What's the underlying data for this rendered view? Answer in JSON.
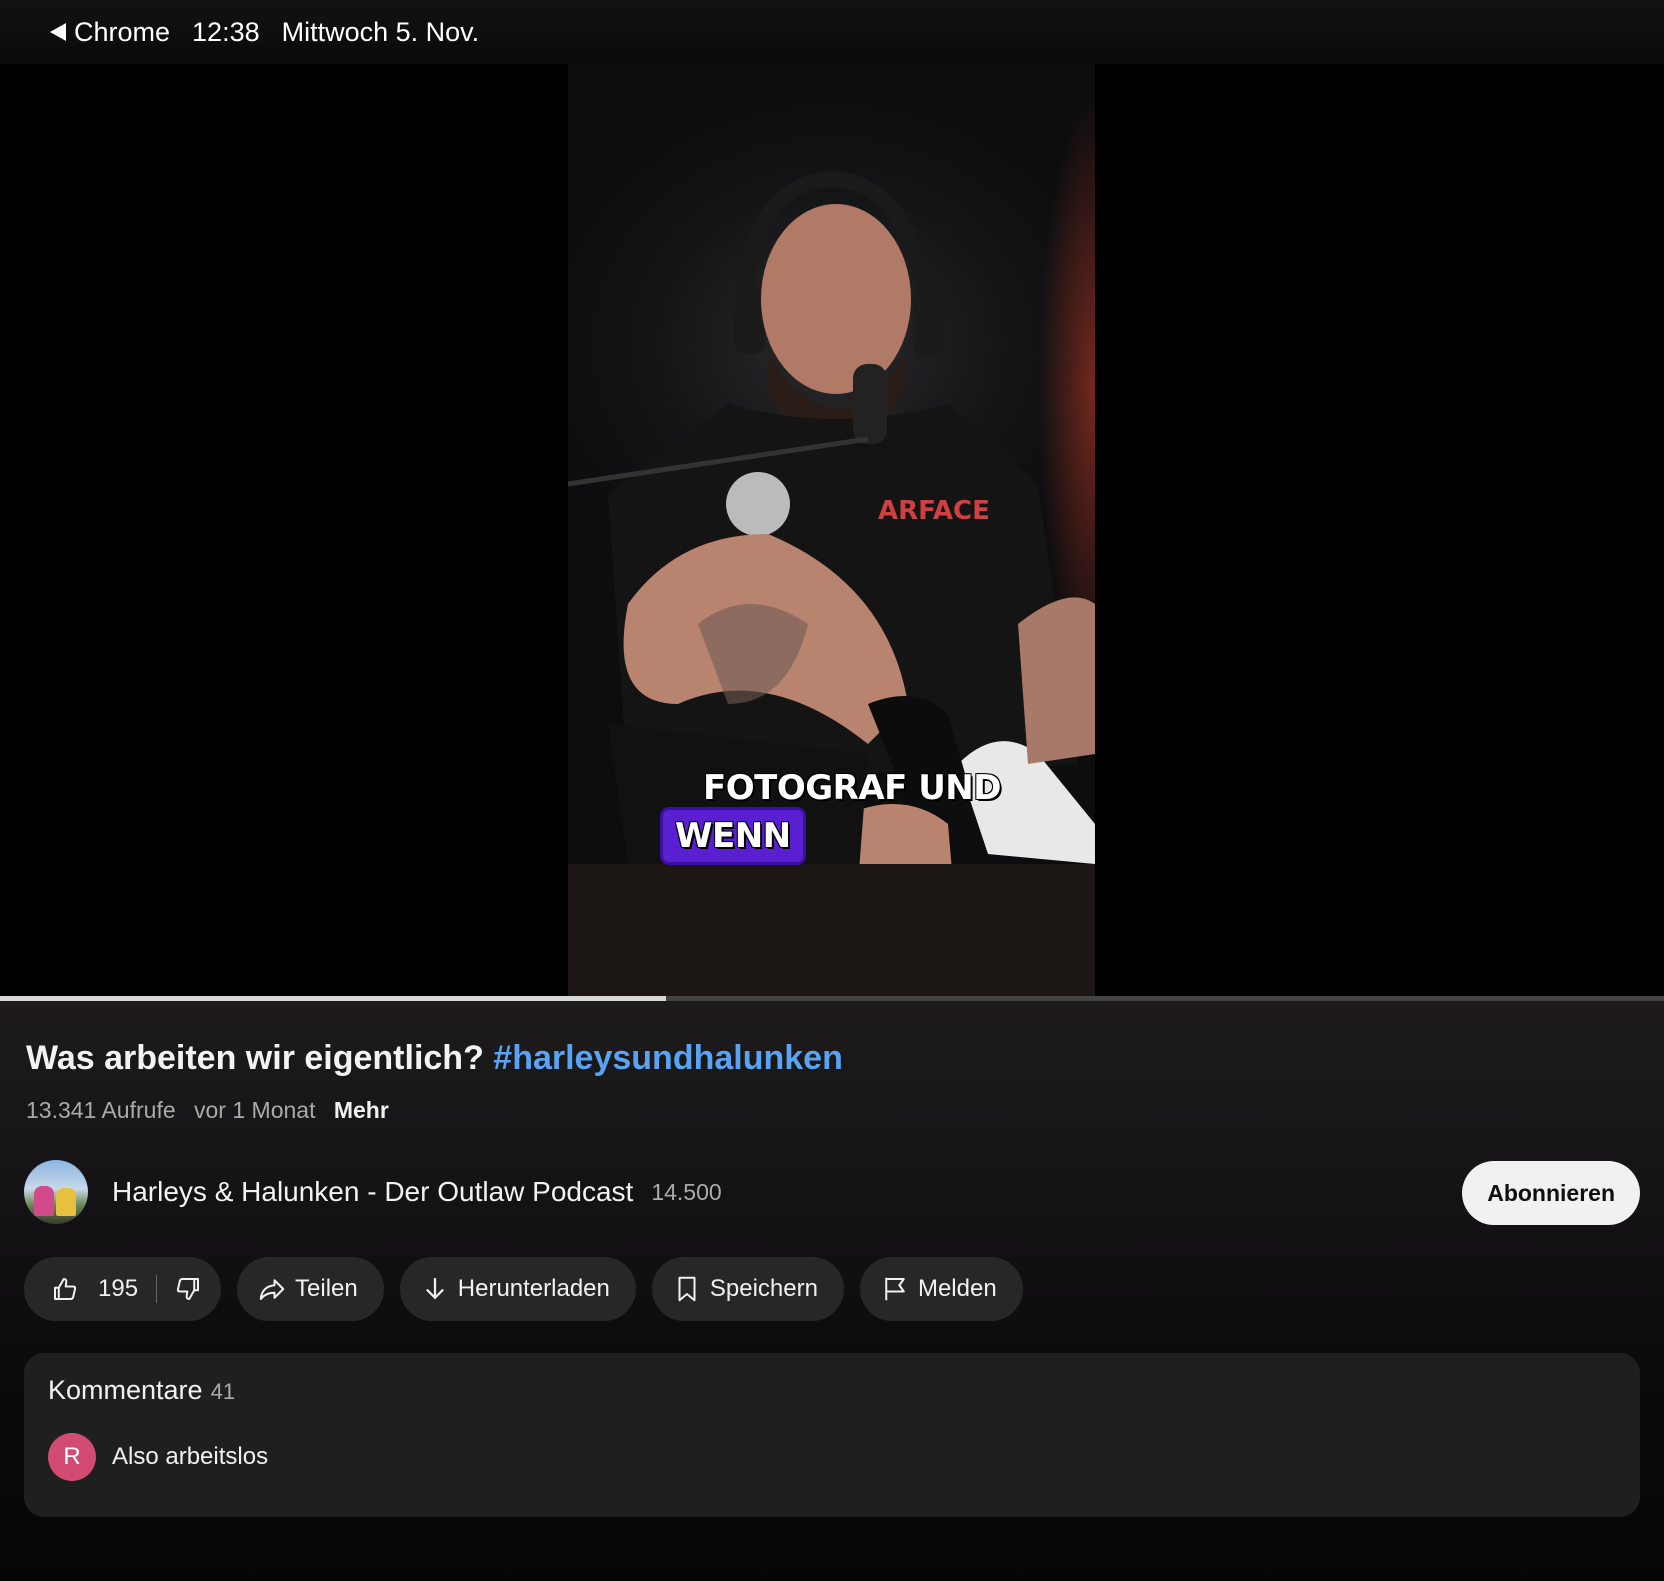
{
  "status_bar": {
    "back_app": "Chrome",
    "time": "12:38",
    "date": "Mittwoch 5. Nov."
  },
  "video": {
    "captions": [
      "FOTOGRAF UND",
      "WENN"
    ],
    "caption_highlight_color": "#5a1fd1",
    "progress_fraction": 0.4
  },
  "info": {
    "title": "Was arbeiten wir eigentlich?",
    "hashtag": "#harleysundhalunken",
    "views": "13.341 Aufrufe",
    "age": "vor 1 Monat",
    "more_label": "Mehr"
  },
  "channel": {
    "name": "Harleys & Halunken - Der Outlaw Podcast",
    "subscribers": "14.500",
    "subscribe_label": "Abonnieren"
  },
  "actions": {
    "like_count": "195",
    "share_label": "Teilen",
    "download_label": "Herunterladen",
    "save_label": "Speichern",
    "report_label": "Melden",
    "icons": [
      "thumbs-up-icon",
      "thumbs-down-icon",
      "share-icon",
      "download-icon",
      "bookmark-icon",
      "flag-icon"
    ]
  },
  "comments": {
    "heading": "Kommentare",
    "count": "41",
    "preview": {
      "avatar_initial": "R",
      "text": "Also arbeitslos"
    }
  },
  "colors": {
    "hashtag": "#5aa2f2",
    "comment_avatar": "#d14b73"
  }
}
